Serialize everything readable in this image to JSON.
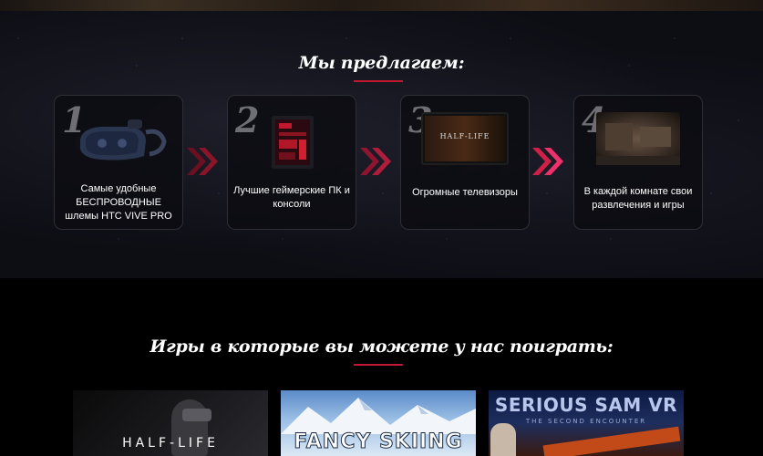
{
  "offer_section": {
    "title": "Мы предлагаем:",
    "cards": [
      {
        "number": "1",
        "text": "Самые удобные БЕСПРОВОДНЫЕ шлемы HTC VIVE PRO",
        "icon": "vr-headset-image"
      },
      {
        "number": "2",
        "text": "Лучшие геймерские ПК и консоли",
        "icon": "gaming-pc-image"
      },
      {
        "number": "3",
        "text": "Огромные телевизоры",
        "icon": "tv-image",
        "screen_text": "HALF-LIFE"
      },
      {
        "number": "4",
        "text": "В каждой комнате свои развлечения и игры",
        "icon": "room-image"
      }
    ],
    "accent_color": "#c0182e"
  },
  "games_section": {
    "title": "Игры в которые вы можете у нас поиграть:",
    "games": [
      {
        "label": "HALF-LIFE"
      },
      {
        "label": "FANCY SKIING"
      },
      {
        "label": "SERIOUS SAM VR",
        "sublabel": "THE SECOND ENCOUNTER"
      }
    ]
  }
}
